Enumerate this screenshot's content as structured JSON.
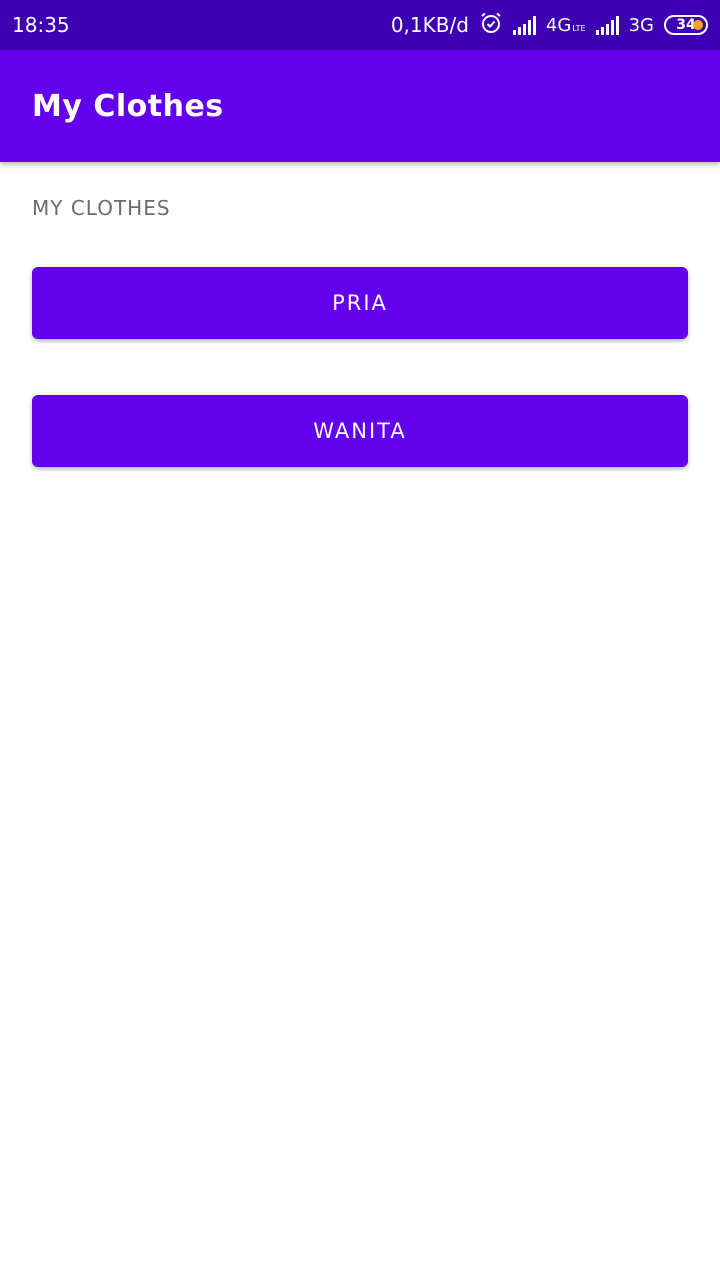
{
  "status_bar": {
    "time": "18:35",
    "data_rate": "0,1KB/d",
    "network_1": "4G",
    "network_1_sub": "LTE",
    "network_2": "3G",
    "battery": "34",
    "icons": [
      "alarm-icon",
      "signal-icon",
      "signal-icon",
      "battery-icon"
    ],
    "battery_dot_color": "#f6a623"
  },
  "app_bar": {
    "title": "My Clothes",
    "color": "#6200ee"
  },
  "main": {
    "section_label": "MY CLOTHES",
    "buttons": [
      {
        "label": "PRIA"
      },
      {
        "label": "WANITA"
      }
    ],
    "button_color": "#6200ee"
  }
}
